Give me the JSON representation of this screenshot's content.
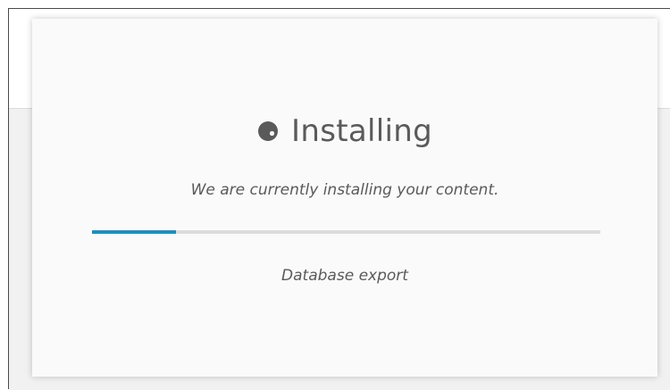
{
  "dialog": {
    "title": "Installing",
    "title_icon": "spinner-icon",
    "message": "We are currently installing your content.",
    "progress_fraction": 0.165,
    "current_step": "Database export"
  },
  "colors": {
    "progress_accent": "#1d8fc0",
    "progress_track": "#dcdcdc",
    "text": "#5a5a5a"
  }
}
